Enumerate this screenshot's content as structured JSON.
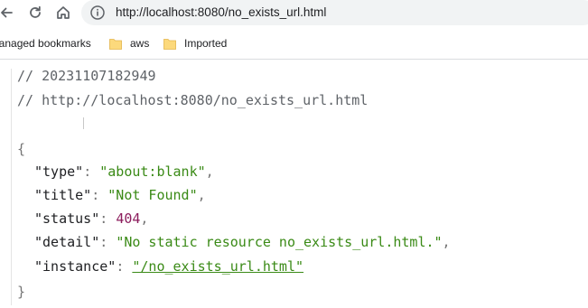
{
  "browser": {
    "url": "http://localhost:8080/no_exists_url.html",
    "bookmarks": [
      {
        "label": "lanaged bookmarks",
        "icon": "folder-icon"
      },
      {
        "label": "aws",
        "icon": "folder-icon"
      },
      {
        "label": "Imported",
        "icon": "folder-icon"
      }
    ]
  },
  "viewer": {
    "comment_timestamp": "// 20231107182949",
    "comment_url": "// http://localhost:8080/no_exists_url.html",
    "open_brace": "{",
    "close_brace": "}",
    "fields": [
      {
        "key": "\"type\"",
        "value": "\"about:blank\"",
        "kind": "string"
      },
      {
        "key": "\"title\"",
        "value": "\"Not Found\"",
        "kind": "string"
      },
      {
        "key": "\"status\"",
        "value": "404",
        "kind": "number"
      },
      {
        "key": "\"detail\"",
        "value": "\"No static resource no_exists_url.html.\"",
        "kind": "string"
      },
      {
        "key": "\"instance\"",
        "value": "\"/no_exists_url.html\"",
        "kind": "link"
      }
    ],
    "colors": {
      "string": "#3a8a16",
      "number": "#8b1c5c",
      "comment": "#5f6368"
    }
  }
}
